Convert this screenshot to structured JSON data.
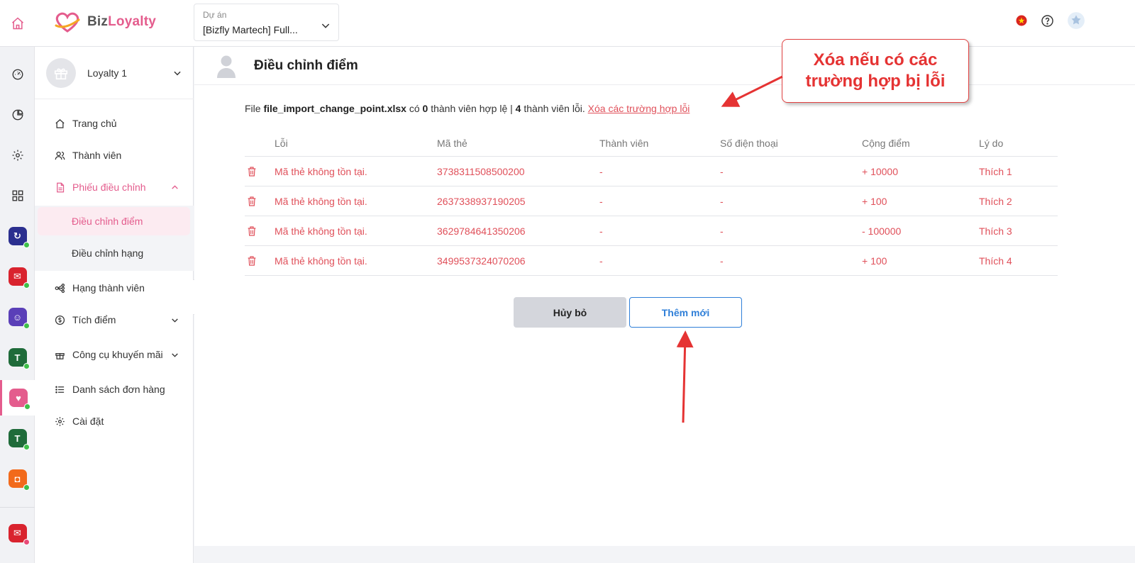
{
  "topbar": {
    "logo": {
      "part1": "Biz",
      "part2": "Loyalty"
    },
    "project": {
      "label": "Dự án",
      "value": "[Bizfly Martech] Full..."
    },
    "icons": [
      "vietnam-flag-icon",
      "help-icon",
      "user-avatar-icon"
    ]
  },
  "rail": {
    "items": [
      "home-icon",
      "dashboard-icon",
      "report-icon",
      "settings-icon",
      "apps-icon",
      "app-1",
      "app-2",
      "app-3",
      "app-4",
      "app-loyalty",
      "app-5",
      "app-6",
      "app-7"
    ]
  },
  "sidebar": {
    "loyalty_name": "Loyalty 1",
    "items": [
      {
        "label": "Trang chủ",
        "icon": "home-icon"
      },
      {
        "label": "Thành viên",
        "icon": "users-icon"
      },
      {
        "label": "Phiếu điều chỉnh",
        "icon": "document-icon"
      },
      {
        "label": "Hạng thành viên",
        "icon": "rank-icon"
      },
      {
        "label": "Tích điểm",
        "icon": "coin-icon"
      },
      {
        "label": "Công cụ khuyến mãi",
        "icon": "gift-icon"
      },
      {
        "label": "Danh sách đơn hàng",
        "icon": "list-icon"
      },
      {
        "label": "Cài đặt",
        "icon": "gear-icon"
      }
    ],
    "sub_items": [
      {
        "label": "Điều chỉnh điểm"
      },
      {
        "label": "Điều chỉnh hạng"
      }
    ]
  },
  "main": {
    "title": "Điều chỉnh điểm",
    "info": {
      "prefix": "File",
      "filename": "file_import_change_point.xlsx",
      "mid1": "có",
      "valid_count": "0",
      "mid2": "thành viên hợp lệ |",
      "error_count": "4",
      "mid3": "thành viên lỗi.",
      "delete_link": "Xóa các trường hợp lỗi"
    },
    "table": {
      "headers": {
        "error": "Lỗi",
        "card": "Mã thẻ",
        "member": "Thành viên",
        "phone": "Số điện thoại",
        "points": "Cộng điểm",
        "reason": "Lý do"
      },
      "rows": [
        {
          "error": "Mã thẻ không tồn tại.",
          "card": "3738311508500200",
          "member": "-",
          "phone": "-",
          "points": "+ 10000",
          "reason": "Thích 1"
        },
        {
          "error": "Mã thẻ không tồn tại.",
          "card": "2637338937190205",
          "member": "-",
          "phone": "-",
          "points": "+ 100",
          "reason": "Thích 2"
        },
        {
          "error": "Mã thẻ không tồn tại.",
          "card": "3629784641350206",
          "member": "-",
          "phone": "-",
          "points": "- 100000",
          "reason": "Thích 3"
        },
        {
          "error": "Mã thẻ không tồn tại.",
          "card": "3499537324070206",
          "member": "-",
          "phone": "-",
          "points": "+ 100",
          "reason": "Thích 4"
        }
      ]
    },
    "buttons": {
      "cancel": "Hủy bỏ",
      "add": "Thêm mới"
    }
  },
  "annotation": {
    "callout": "Xóa nếu có các trường hợp bị lỗi"
  },
  "colors": {
    "accent_pink": "#e45c8d",
    "error_red": "#e0505a",
    "primary_blue": "#2f7fd8",
    "callout_red": "#e53333"
  }
}
